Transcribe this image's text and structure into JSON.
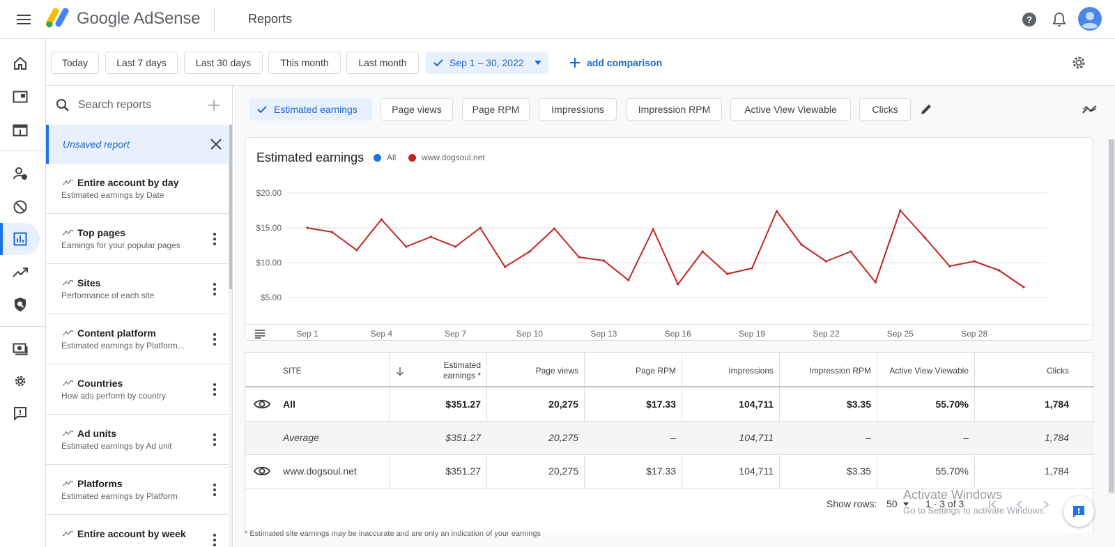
{
  "app": {
    "brand": "Google AdSense",
    "page_title": "Reports"
  },
  "date_bar": {
    "chips": [
      "Today",
      "Last 7 days",
      "Last 30 days",
      "This month",
      "Last month"
    ],
    "selected_range": "Sep 1 – 30, 2022",
    "add_comparison": "add comparison"
  },
  "sidebar": {
    "search_placeholder": "Search reports",
    "unsaved_label": "Unsaved report",
    "reports": [
      {
        "title": "Entire account by day",
        "subtitle": "Estimated earnings by Date"
      },
      {
        "title": "Top pages",
        "subtitle": "Earnings for your popular pages"
      },
      {
        "title": "Sites",
        "subtitle": "Performance of each site"
      },
      {
        "title": "Content platform",
        "subtitle": "Estimated earnings by Platform..."
      },
      {
        "title": "Countries",
        "subtitle": "How ads perform by country"
      },
      {
        "title": "Ad units",
        "subtitle": "Estimated earnings by Ad unit"
      },
      {
        "title": "Platforms",
        "subtitle": "Estimated earnings by Platform"
      },
      {
        "title": "Entire account by week",
        "subtitle": ""
      }
    ]
  },
  "metrics": [
    "Estimated earnings",
    "Page views",
    "Page RPM",
    "Impressions",
    "Impression RPM",
    "Active View Viewable",
    "Clicks"
  ],
  "colors": {
    "accent": "#1a73e8",
    "all_series": "#1a73e8",
    "site_series": "#c5221f"
  },
  "chart_data": {
    "type": "line",
    "title": "Estimated earnings",
    "legend": [
      "All",
      "www.dogsoul.net"
    ],
    "y_ticks": [
      "$20.00",
      "$15.00",
      "$10.00",
      "$5.00"
    ],
    "x_ticks": [
      "Sep 1",
      "Sep 4",
      "Sep 7",
      "Sep 10",
      "Sep 13",
      "Sep 16",
      "Sep 19",
      "Sep 22",
      "Sep 25",
      "Sep 28"
    ],
    "x": [
      1,
      2,
      3,
      4,
      5,
      6,
      7,
      8,
      9,
      10,
      11,
      12,
      13,
      14,
      15,
      16,
      17,
      18,
      19,
      20,
      21,
      22,
      23,
      24,
      25,
      26,
      27,
      28,
      29,
      30
    ],
    "ylim": [
      2.5,
      22.5
    ],
    "series": [
      {
        "name": "www.dogsoul.net",
        "values": [
          15.0,
          14.4,
          11.8,
          16.2,
          12.3,
          13.7,
          12.3,
          15.0,
          9.4,
          11.6,
          14.9,
          10.8,
          10.3,
          7.5,
          14.8,
          6.9,
          11.6,
          8.4,
          9.2,
          17.4,
          12.6,
          10.2,
          11.6,
          7.2,
          17.5,
          13.6,
          9.5,
          10.2,
          8.9,
          6.5
        ]
      }
    ]
  },
  "table": {
    "headers": [
      "SITE",
      "Estimated earnings *",
      "Page views",
      "Page RPM",
      "Impressions",
      "Impression RPM",
      "Active View Viewable",
      "Clicks"
    ],
    "total": {
      "site": "All",
      "values": [
        "$351.27",
        "20,275",
        "$17.33",
        "104,711",
        "$3.35",
        "55.70%",
        "1,784"
      ]
    },
    "average": {
      "site": "Average",
      "values": [
        "$351.27",
        "20,275",
        "–",
        "104,711",
        "–",
        "–",
        "1,784"
      ]
    },
    "rows": [
      {
        "site": "www.dogsoul.net",
        "values": [
          "$351.27",
          "20,275",
          "$17.33",
          "104,711",
          "$3.35",
          "55.70%",
          "1,784"
        ]
      }
    ],
    "show_rows_label": "Show rows:",
    "rows_per_page": "50",
    "range": "1 - 3 of 3",
    "footnote": "* Estimated site earnings may be inaccurate and are only an indication of your earnings"
  },
  "watermark": {
    "line1": "Activate Windows",
    "line2": "Go to Settings to activate Windows."
  }
}
